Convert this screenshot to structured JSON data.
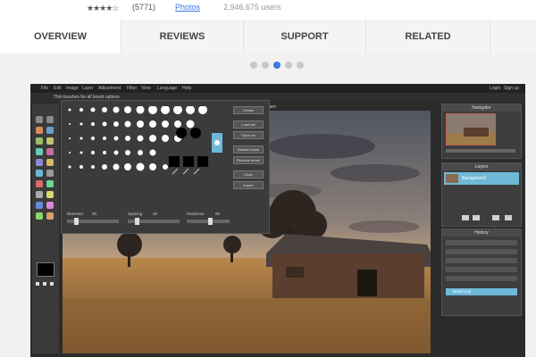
{
  "store": {
    "stars": "★★★★☆",
    "rating_count": "(5771)",
    "category": "Photos",
    "users": "2,946,675 users"
  },
  "tabs": [
    {
      "label": "OVERVIEW",
      "active": true
    },
    {
      "label": "REVIEWS",
      "active": false
    },
    {
      "label": "SUPPORT",
      "active": false
    },
    {
      "label": "RELATED",
      "active": false
    }
  ],
  "carousel": {
    "count": 5,
    "active_index": 2
  },
  "editor": {
    "menu": [
      "File",
      "Edit",
      "Image",
      "Layer",
      "Adjustment",
      "Filter",
      "View",
      "Language",
      "Help"
    ],
    "menu_right": [
      "Login",
      "Sign up"
    ],
    "message": "Thin brushes for all brush options",
    "canvas_label": "barn",
    "brush_buttons": [
      "Create",
      "Load set",
      "Save set",
      "Disable brush",
      "Remove brush",
      "Clear",
      "Import"
    ],
    "sliders": [
      {
        "label": "Diameter",
        "value": "30"
      },
      {
        "label": "Spacing",
        "value": "25"
      },
      {
        "label": "Hardness",
        "value": "50"
      }
    ],
    "panels": {
      "navigator": "Navigator",
      "layers": "Layers",
      "history": "History",
      "layer_name": "Background",
      "history_selected": "Brush tool"
    },
    "colors": {
      "accent": "#6fb9d8",
      "sky_top": "#5a5f6b",
      "field": "#a07b4a"
    }
  }
}
